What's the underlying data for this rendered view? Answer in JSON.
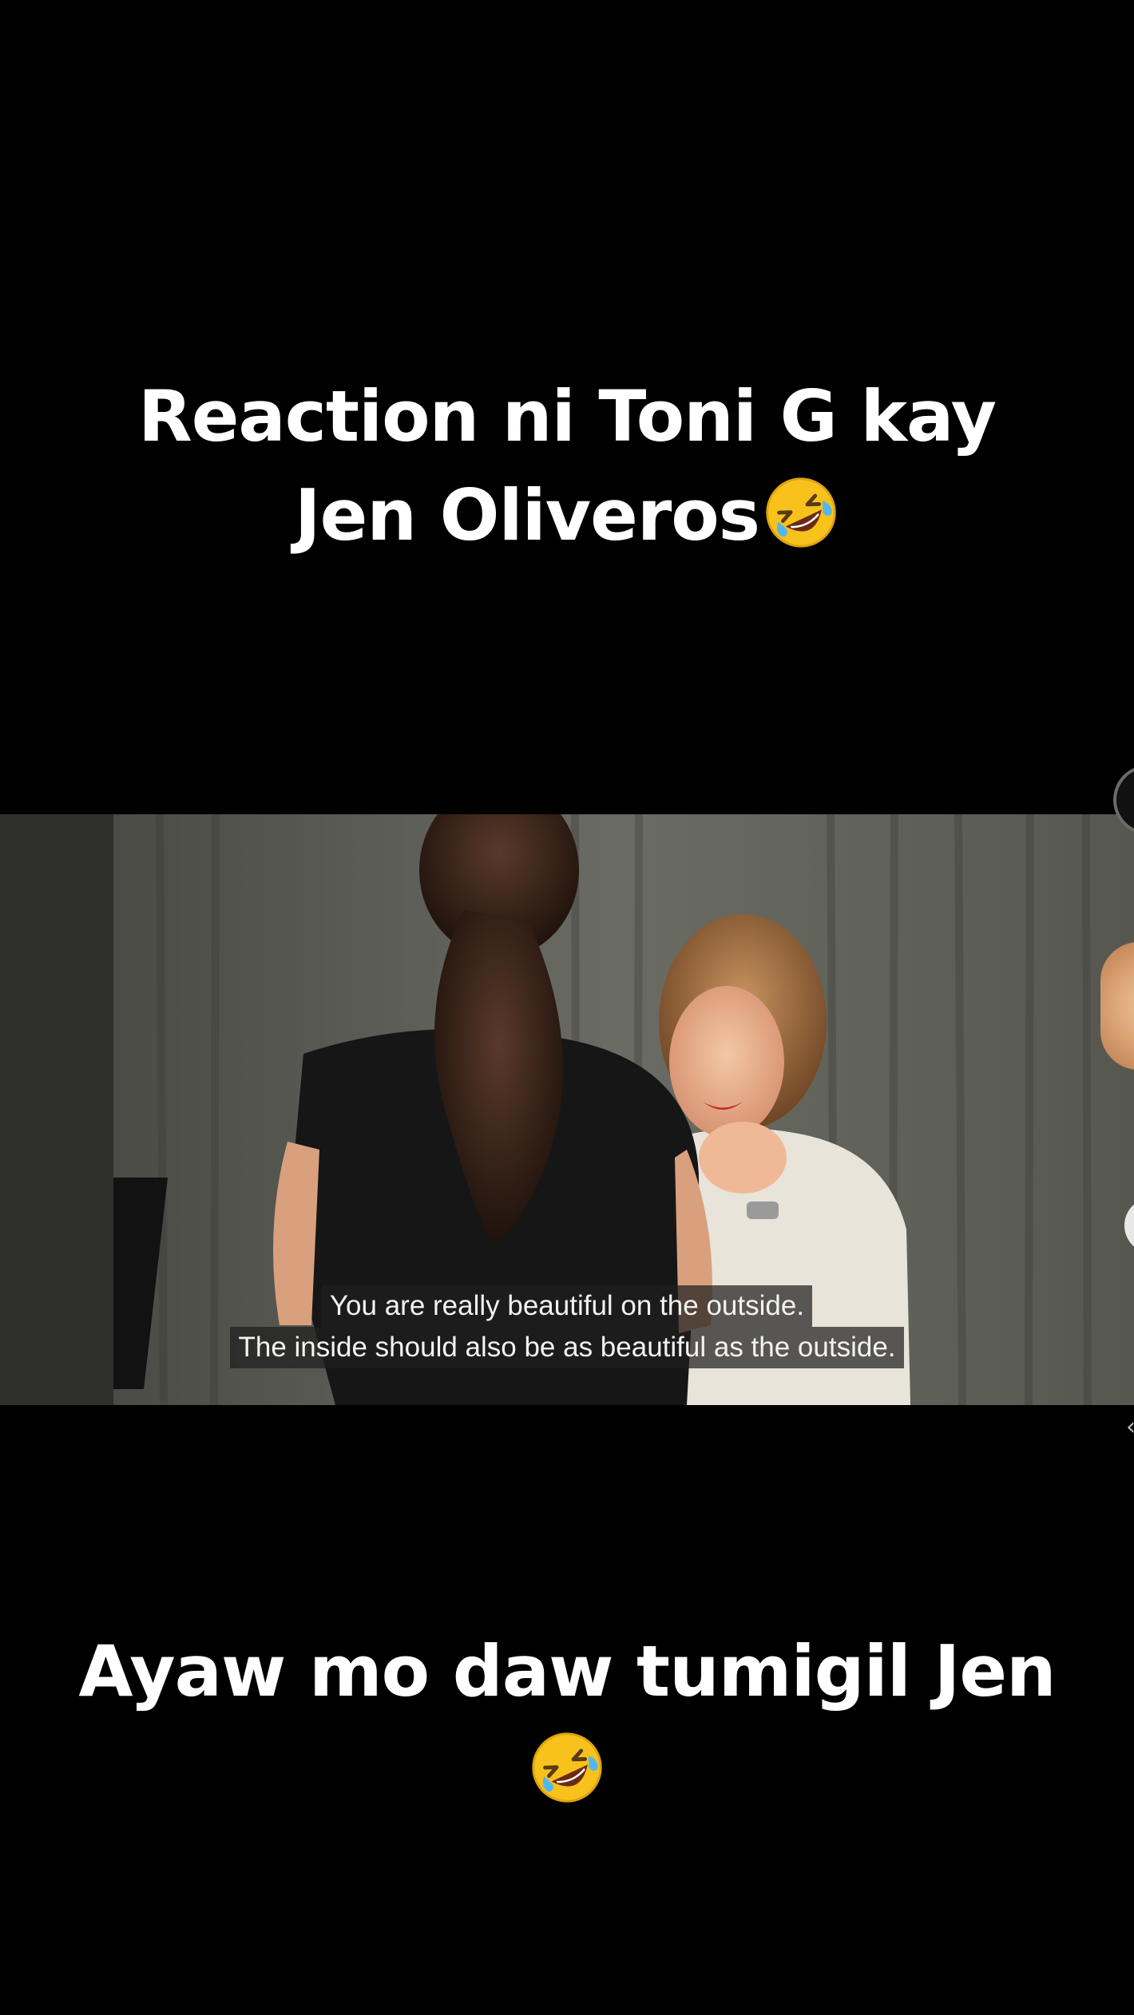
{
  "overlay": {
    "top_caption_line1": "Reaction ni Toni G kay",
    "top_caption_line2": "Jen Oliveros",
    "bottom_caption_line1": "Ayaw mo daw tumigil Jen",
    "caption_emoji": "rolling-on-the-floor-laughing-emoji"
  },
  "video": {
    "subtitle_line1": "You are really beautiful on the outside.",
    "subtitle_line2": "The inside should also be as beautiful as the outside."
  },
  "side_actions": {
    "profile_icon": "profile-avatar-icon",
    "avatar_icon": "creator-avatar-icon",
    "action_icon": "action-button-icon",
    "arrow_icon": "chevron-icon"
  },
  "colors": {
    "background": "#000000",
    "caption_text": "#ffffff",
    "subtitle_bg": "#1e1e1e"
  }
}
